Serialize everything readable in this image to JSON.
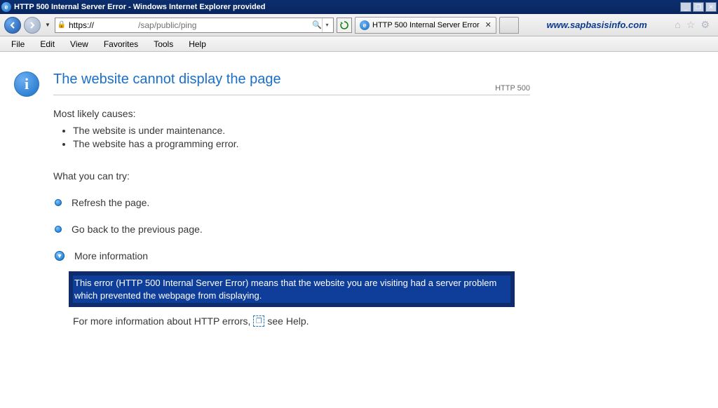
{
  "window": {
    "title": "HTTP 500 Internal Server Error - Windows Internet Explorer provided"
  },
  "nav": {
    "protocol": "https://",
    "path": "/sap/public/ping",
    "tab_label": "HTTP 500 Internal Server Error",
    "brand": "www.sapbasisinfo.com"
  },
  "menu": {
    "items": [
      "File",
      "Edit",
      "View",
      "Favorites",
      "Tools",
      "Help"
    ]
  },
  "page": {
    "title": "The website cannot display the page",
    "http_code": "HTTP 500",
    "causes_label": "Most likely causes:",
    "causes": [
      "The website is under maintenance.",
      "The website has a programming error."
    ],
    "try_label": "What you can try:",
    "try_items": [
      "Refresh the page.",
      "Go back to the previous page."
    ],
    "more_info_label": "More information",
    "more_info_text": "This error (HTTP 500 Internal Server Error) means that the website you are visiting had a server problem which prevented the webpage from displaying.",
    "help_prefix": "For more information about HTTP errors, ",
    "help_link": "see Help."
  }
}
